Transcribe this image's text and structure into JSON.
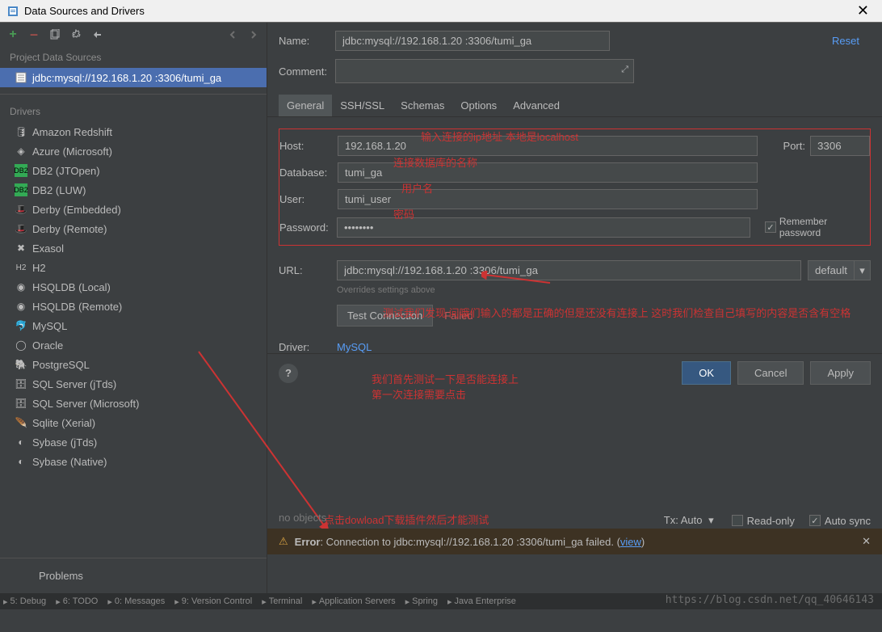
{
  "titlebar": {
    "title": "Data Sources and Drivers"
  },
  "sidebar": {
    "sources_header": "Project Data Sources",
    "source_item": "jdbc:mysql://192.168.1.20 :3306/tumi_ga",
    "drivers_header": "Drivers",
    "drivers": [
      "Amazon Redshift",
      "Azure (Microsoft)",
      "DB2 (JTOpen)",
      "DB2 (LUW)",
      "Derby (Embedded)",
      "Derby (Remote)",
      "Exasol",
      "H2",
      "HSQLDB (Local)",
      "HSQLDB (Remote)",
      "MySQL",
      "Oracle",
      "PostgreSQL",
      "SQL Server (jTds)",
      "SQL Server (Microsoft)",
      "Sqlite (Xerial)",
      "Sybase (jTds)",
      "Sybase (Native)"
    ],
    "problems": "Problems"
  },
  "form": {
    "name_label": "Name:",
    "name_value": "jdbc:mysql://192.168.1.20 :3306/tumi_ga",
    "reset": "Reset",
    "comment_label": "Comment:",
    "tabs": [
      "General",
      "SSH/SSL",
      "Schemas",
      "Options",
      "Advanced"
    ],
    "host_label": "Host:",
    "host_value": "192.168.1.20",
    "port_label": "Port:",
    "port_value": "3306",
    "db_label": "Database:",
    "db_value": "tumi_ga",
    "user_label": "User:",
    "user_value": "tumi_user",
    "pw_label": "Password:",
    "pw_value": "••••••••",
    "remember_pw": "Remember password",
    "url_label": "URL:",
    "url_value": "jdbc:mysql://192.168.1.20 :3306/tumi_ga",
    "url_mode": "default",
    "override": "Overrides settings above",
    "test_btn": "Test Connection",
    "test_status": "Failed",
    "driver_label": "Driver:",
    "driver_link": "MySQL",
    "no_objects": "no objects"
  },
  "annotations": {
    "host": "输入连接的ip地址   本地是localhost",
    "db": "连接数据库的名称",
    "user": "用户名",
    "pw": "密码",
    "test1": "测试我们发现   问哦们输入的都是正确的但是还没有连接上  这时我们检查自己填写的内容是否含有空格",
    "test2a": "我们首先测试一下是否能连接上",
    "test2b": "第一次连接需要点击",
    "download": "点击dowload下载插件然后才能测试"
  },
  "footer": {
    "tx_label": "Tx:",
    "tx_value": "Auto",
    "readonly": "Read-only",
    "autosync": "Auto sync"
  },
  "error": {
    "prefix": "Error",
    "msg": ": Connection to jdbc:mysql://192.168.1.20 :3306/tumi_ga failed. (",
    "view": "view",
    "suffix": ")"
  },
  "buttons": {
    "ok": "OK",
    "cancel": "Cancel",
    "apply": "Apply"
  },
  "statusbar": {
    "items": [
      "5: Debug",
      "6: TODO",
      "0: Messages",
      "9: Version Control",
      "Terminal",
      "Application Servers",
      "Spring",
      "Java Enterprise"
    ]
  },
  "watermark": "https://blog.csdn.net/qq_40646143"
}
